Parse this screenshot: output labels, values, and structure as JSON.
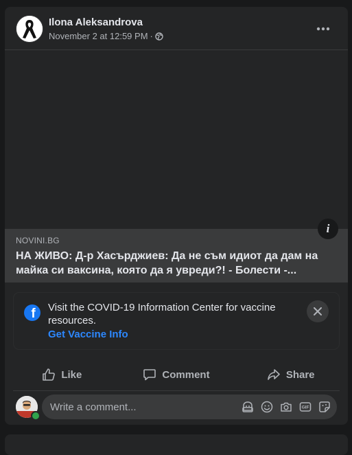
{
  "post": {
    "author": "Ilona Aleksandrova",
    "timestamp": "November 2 at 12:59 PM",
    "separator": "·"
  },
  "link": {
    "domain": "NOVINI.BG",
    "title": "НА ЖИВО: Д-р Хасърджиев: Да не съм идиот да дам на майка си ваксина, която да я увреди?! - Болести -..."
  },
  "info_button": "i",
  "covid": {
    "text": "Visit the COVID-19 Information Center for vaccine resources.",
    "link": "Get Vaccine Info"
  },
  "actions": {
    "like": "Like",
    "comment": "Comment",
    "share": "Share"
  },
  "comment": {
    "placeholder": "Write a comment..."
  },
  "colors": {
    "card": "#242526",
    "background": "#18191a",
    "accent": "#2d88ff",
    "facebook_blue": "#1877f2",
    "online": "#31a24c"
  },
  "icons": [
    "black-ribbon-avatar",
    "globe-icon",
    "more-icon",
    "info-icon",
    "facebook-logo-icon",
    "close-icon",
    "like-icon",
    "comment-icon",
    "share-icon",
    "avatar-sticker-icon",
    "emoji-icon",
    "camera-icon",
    "gif-icon",
    "sticker-icon"
  ]
}
